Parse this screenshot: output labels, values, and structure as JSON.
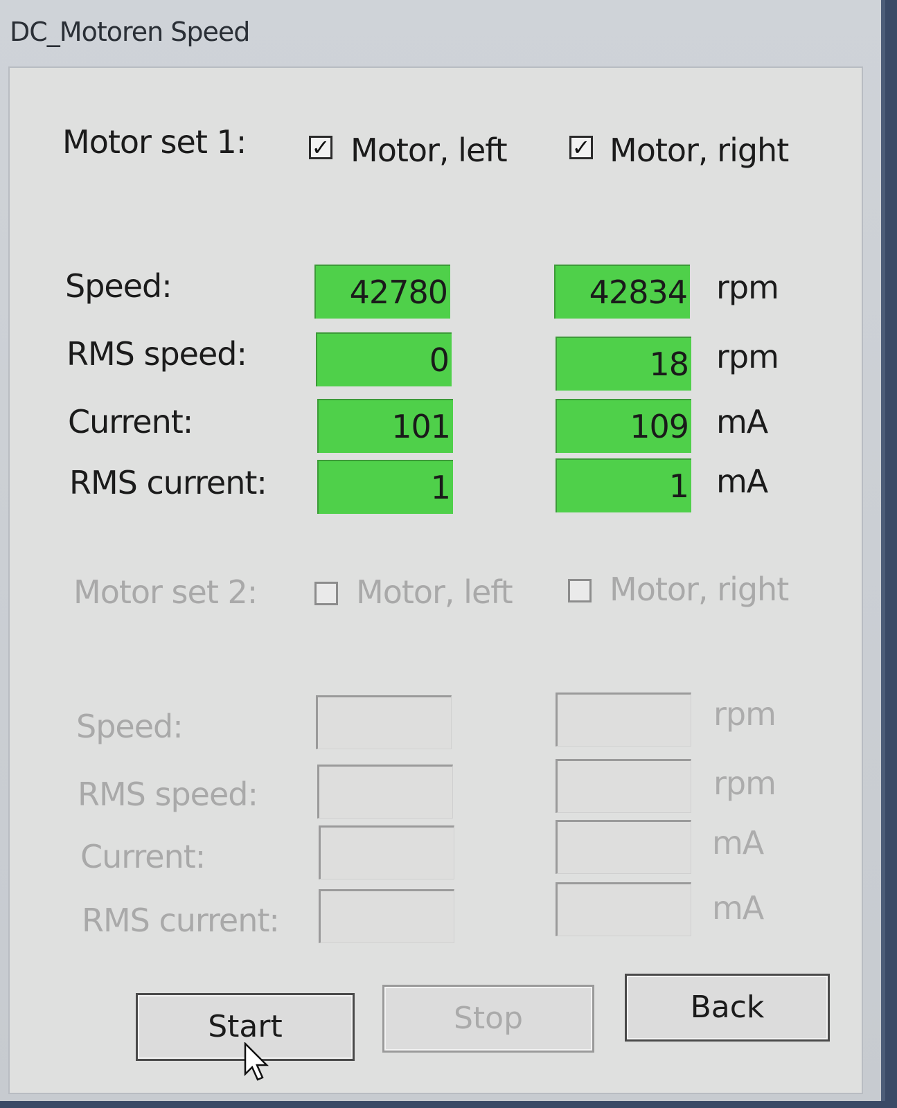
{
  "window": {
    "title": "DC_Motoren Speed"
  },
  "set1": {
    "label": "Motor set 1:",
    "left_checkbox": {
      "label": "Motor, left",
      "checked": true
    },
    "right_checkbox": {
      "label": "Motor, right",
      "checked": true
    },
    "rows": [
      {
        "label": "Speed:",
        "left": "42780",
        "right": "42834",
        "unit": "rpm"
      },
      {
        "label": "RMS speed:",
        "left": "0",
        "right": "18",
        "unit": "rpm"
      },
      {
        "label": "Current:",
        "left": "101",
        "right": "109",
        "unit": "mA"
      },
      {
        "label": "RMS current:",
        "left": "1",
        "right": "1",
        "unit": "mA"
      }
    ],
    "highlight_color": "#4fd04a"
  },
  "set2": {
    "label": "Motor set 2:",
    "left_checkbox": {
      "label": "Motor, left",
      "checked": false
    },
    "right_checkbox": {
      "label": "Motor, right",
      "checked": false
    },
    "rows": [
      {
        "label": "Speed:",
        "left": "",
        "right": "",
        "unit": "rpm"
      },
      {
        "label": "RMS speed:",
        "left": "",
        "right": "",
        "unit": "rpm"
      },
      {
        "label": "Current:",
        "left": "",
        "right": "",
        "unit": "mA"
      },
      {
        "label": "RMS current:",
        "left": "",
        "right": "",
        "unit": "mA"
      }
    ]
  },
  "buttons": {
    "start": "Start",
    "stop": "Stop",
    "back": "Back"
  },
  "icons": {
    "checkmark": "check-icon",
    "cursor": "mouse-pointer-icon"
  }
}
